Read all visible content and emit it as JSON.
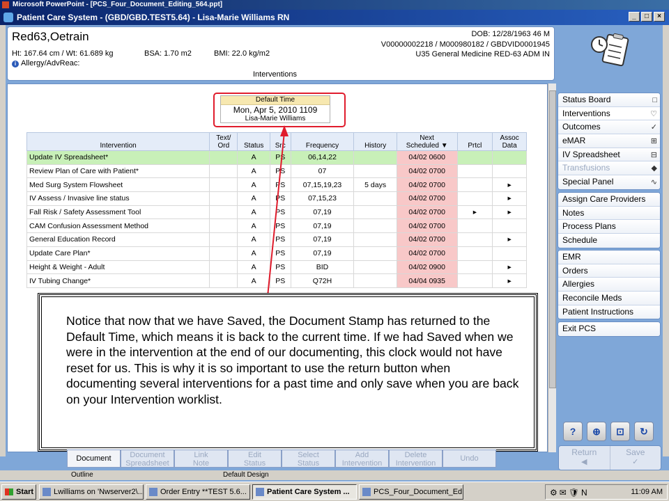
{
  "ppt_window": {
    "title": "Microsoft PowerPoint - [PCS_Four_Document_Editing_564.ppt]"
  },
  "pcs_window": {
    "title": "Patient Care System - (GBD/GBD.TEST5.64) - Lisa-Marie Williams RN"
  },
  "patient": {
    "name": "Red63,Oetrain",
    "dob": "DOB: 12/28/1963 46 M",
    "ids": "V00000002218 / M000980182 / GBDVID0001945",
    "location": "U35 General Medicine  RED-63  ADM IN",
    "ht_wt": "Ht: 167.64 cm / Wt: 61.689 kg",
    "bsa": "BSA: 1.70 m2",
    "bmi": "BMI: 22.0 kg/m2",
    "allergy": "Allergy/AdvReac:"
  },
  "page_title": "Interventions",
  "stamp": {
    "header": "Default Time",
    "time": "Mon, Apr 5, 2010  1109",
    "user": "Lisa-Marie Williams"
  },
  "table": {
    "headers": {
      "intervention": "Intervention",
      "text_ord_1": "Text/",
      "text_ord_2": "Ord",
      "status": "Status",
      "src": "Src",
      "frequency": "Frequency",
      "history": "History",
      "next_1": "Next",
      "next_2": "Scheduled",
      "prtcl": "Prtcl",
      "assoc_1": "Assoc",
      "assoc_2": "Data"
    },
    "rows": [
      {
        "name": "Update IV Spreadsheet*",
        "status": "A",
        "src": "PS",
        "freq": "06,14,22",
        "history": "",
        "next": "04/02 0600",
        "prtcl": "",
        "assoc": ""
      },
      {
        "name": "Review Plan of Care with Patient*",
        "status": "A",
        "src": "PS",
        "freq": "07",
        "history": "",
        "next": "04/02 0700",
        "prtcl": "",
        "assoc": ""
      },
      {
        "name": "Med Surg System Flowsheet",
        "status": "A",
        "src": "PS",
        "freq": "07,15,19,23",
        "history": "5 days",
        "next": "04/02 0700",
        "prtcl": "",
        "assoc": "▸"
      },
      {
        "name": "IV Assess / Invasive line status",
        "status": "A",
        "src": "PS",
        "freq": "07,15,23",
        "history": "",
        "next": "04/02 0700",
        "prtcl": "",
        "assoc": "▸"
      },
      {
        "name": "Fall Risk / Safety Assessment Tool",
        "status": "A",
        "src": "PS",
        "freq": "07,19",
        "history": "",
        "next": "04/02 0700",
        "prtcl": "▸",
        "assoc": "▸"
      },
      {
        "name": "CAM Confusion Assessment Method",
        "status": "A",
        "src": "PS",
        "freq": "07,19",
        "history": "",
        "next": "04/02 0700",
        "prtcl": "",
        "assoc": ""
      },
      {
        "name": "General Education Record",
        "status": "A",
        "src": "PS",
        "freq": "07,19",
        "history": "",
        "next": "04/02 0700",
        "prtcl": "",
        "assoc": "▸"
      },
      {
        "name": "Update Care Plan*",
        "status": "A",
        "src": "PS",
        "freq": "07,19",
        "history": "",
        "next": "04/02 0700",
        "prtcl": "",
        "assoc": ""
      },
      {
        "name": "Height & Weight - Adult",
        "status": "A",
        "src": "PS",
        "freq": "BID",
        "history": "",
        "next": "04/02 0900",
        "prtcl": "",
        "assoc": "▸"
      },
      {
        "name": "IV Tubing Change*",
        "status": "A",
        "src": "PS",
        "freq": "Q72H",
        "history": "",
        "next": "04/04 0935",
        "prtcl": "",
        "assoc": "▸"
      }
    ]
  },
  "callout": {
    "text": "Notice that now that we have Saved, the Document Stamp has returned to the Default Time, which means it is back to the current time. If we had Saved when we were in the intervention at the end of our documenting, this clock would not have reset for us. This is why it is so important to use the return button when documenting several interventions for a past time and only save when you are back on your Intervention worklist."
  },
  "sidebar": {
    "group1": [
      {
        "label": "Status Board",
        "icon": "□"
      },
      {
        "label": "Interventions",
        "icon": "♡"
      },
      {
        "label": "Outcomes",
        "icon": "✓"
      },
      {
        "label": "eMAR",
        "icon": "⊞"
      },
      {
        "label": "IV Spreadsheet",
        "icon": "⊟"
      },
      {
        "label": "Transfusions",
        "icon": "◆"
      },
      {
        "label": "Special Panel",
        "icon": "∿"
      }
    ],
    "group2": [
      {
        "label": "Assign Care Providers"
      },
      {
        "label": "Notes"
      },
      {
        "label": "Process Plans"
      },
      {
        "label": "Schedule"
      }
    ],
    "group3": [
      {
        "label": "EMR"
      },
      {
        "label": "Orders"
      },
      {
        "label": "Allergies"
      },
      {
        "label": "Reconcile Meds"
      },
      {
        "label": "Patient Instructions"
      }
    ],
    "exit": "Exit PCS"
  },
  "tool_icons": [
    "?",
    "⊕",
    "⊡",
    "↻"
  ],
  "nav": {
    "return": "Return",
    "save": "Save"
  },
  "bottom_buttons": [
    {
      "l1": "Document",
      "l2": ""
    },
    {
      "l1": "Document",
      "l2": "Spreadsheet"
    },
    {
      "l1": "Link",
      "l2": "Note"
    },
    {
      "l1": "Edit",
      "l2": "Status"
    },
    {
      "l1": "Select",
      "l2": "Status"
    },
    {
      "l1": "Add",
      "l2": "Intervention"
    },
    {
      "l1": "Delete",
      "l2": "Intervention"
    },
    {
      "l1": "Undo",
      "l2": ""
    }
  ],
  "ppt_status": {
    "outline": "Outline",
    "design": "Default Design"
  },
  "taskbar": {
    "start": "Start",
    "tasks": [
      "Lwilliams on 'Nwserver2\\...",
      "Order Entry **TEST 5.6...",
      "Patient Care System ...",
      "PCS_Four_Document_Ed..."
    ],
    "clock": "11:09 AM"
  }
}
